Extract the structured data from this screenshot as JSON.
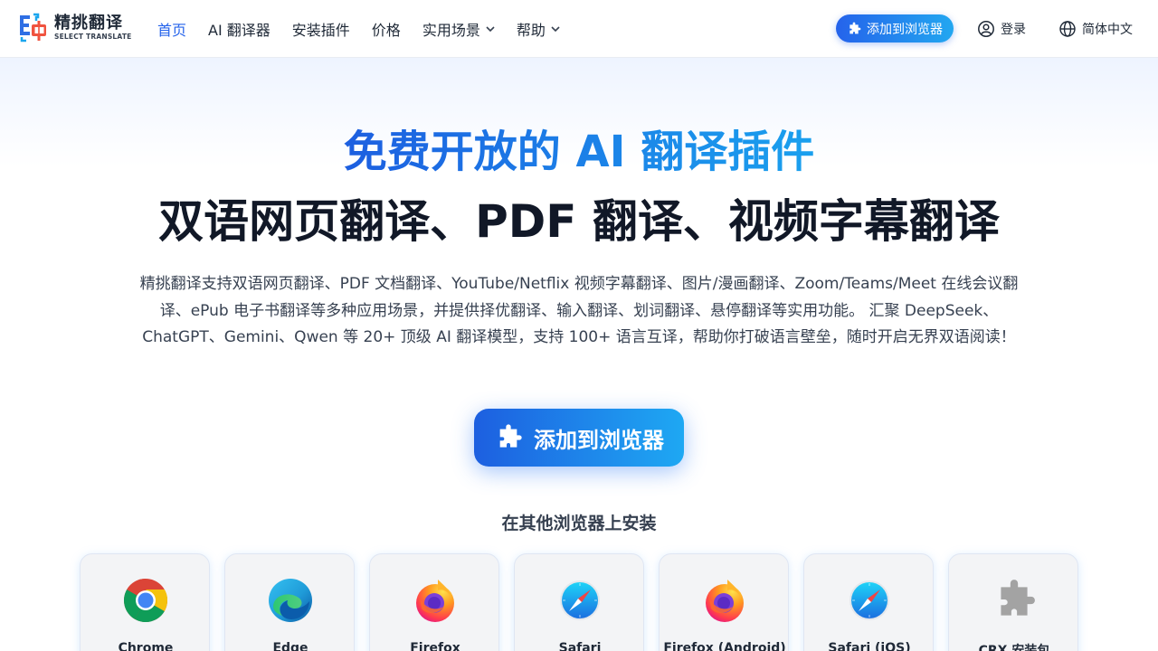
{
  "header": {
    "logo": {
      "name_cn": "精挑翻译",
      "name_en": "SELECT TRANSLATE"
    },
    "nav": [
      {
        "label": "首页",
        "active": true,
        "dropdown": false
      },
      {
        "label": "AI 翻译器",
        "active": false,
        "dropdown": false
      },
      {
        "label": "安装插件",
        "active": false,
        "dropdown": false
      },
      {
        "label": "价格",
        "active": false,
        "dropdown": false
      },
      {
        "label": "实用场景",
        "active": false,
        "dropdown": true
      },
      {
        "label": "帮助",
        "active": false,
        "dropdown": true
      }
    ],
    "add_button": "添加到浏览器",
    "login": "登录",
    "language": "简体中文"
  },
  "hero": {
    "headline_highlight": "免费开放的 AI 翻译插件",
    "headline_main": "双语网页翻译、PDF 翻译、视频字幕翻译",
    "description": "精挑翻译支持双语网页翻译、PDF 文档翻译、YouTube/Netflix 视频字幕翻译、图片/漫画翻译、Zoom/Teams/Meet 在线会议翻译、ePub 电子书翻译等多种应用场景，并提供择优翻译、输入翻译、划词翻译、悬停翻译等实用功能。 汇聚 DeepSeek、ChatGPT、Gemini、Qwen 等 20+ 顶级 AI 翻译模型，支持 100+ 语言互译，帮助你打破语言壁垒，随时开启无界双语阅读！",
    "cta": "添加到浏览器"
  },
  "browsers": {
    "title": "在其他浏览器上安装",
    "items": [
      {
        "label": "Chrome",
        "icon": "chrome-icon"
      },
      {
        "label": "Edge",
        "icon": "edge-icon"
      },
      {
        "label": "Firefox",
        "icon": "firefox-icon"
      },
      {
        "label": "Safari",
        "icon": "safari-icon"
      },
      {
        "label": "Firefox (Android)",
        "icon": "firefox-icon"
      },
      {
        "label": "Safari (iOS)",
        "icon": "safari-icon"
      },
      {
        "label": "CRX 安装包",
        "icon": "puzzle-icon"
      }
    ]
  },
  "colors": {
    "accent": "#2563eb",
    "accent_light": "#1ea8f3",
    "text_dark": "#111827"
  }
}
